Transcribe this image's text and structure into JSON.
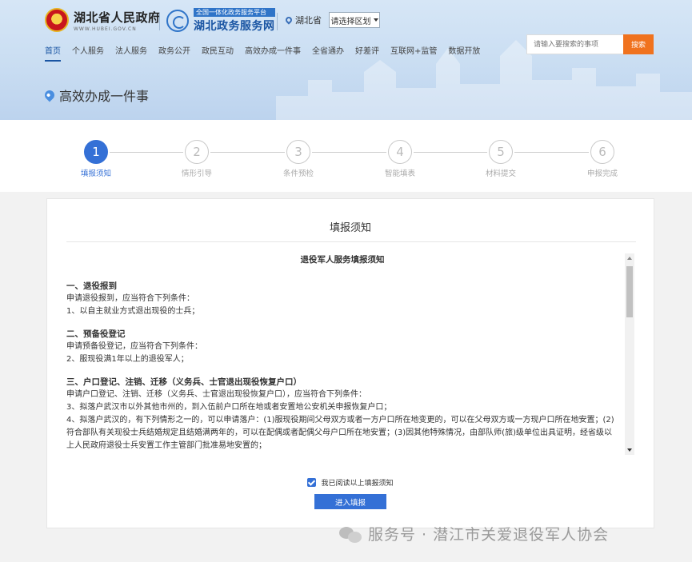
{
  "header": {
    "gov_title": "湖北省人民政府",
    "gov_subtitle": "WWW.HUBEI.GOV.CN",
    "platform_tag": "全国一体化政务服务平台",
    "platform_name": "湖北政务服务网",
    "region_label": "湖北省",
    "region_select": "请选择区划",
    "search_placeholder": "请输入要搜索的事项",
    "search_button": "搜索"
  },
  "nav": {
    "items": [
      "首页",
      "个人服务",
      "法人服务",
      "政务公开",
      "政民互动",
      "高效办成一件事",
      "全省通办",
      "好差评",
      "互联网+监管",
      "数据开放"
    ],
    "active_index": 0
  },
  "page": {
    "title": "高效办成一件事"
  },
  "steps": [
    {
      "num": "1",
      "label": "填报须知",
      "active": true
    },
    {
      "num": "2",
      "label": "情形引导",
      "active": false
    },
    {
      "num": "3",
      "label": "条件预检",
      "active": false
    },
    {
      "num": "4",
      "label": "智能填表",
      "active": false
    },
    {
      "num": "5",
      "label": "材料提交",
      "active": false
    },
    {
      "num": "6",
      "label": "申报完成",
      "active": false
    }
  ],
  "panel": {
    "title": "填报须知",
    "notice_heading": "退役军人服务填报须知",
    "sections": [
      {
        "title": "一、退役报到",
        "lines": [
          "申请退役报到，应当符合下列条件：",
          "1、以自主就业方式退出现役的士兵；"
        ]
      },
      {
        "title": "二、预备役登记",
        "lines": [
          "申请预备役登记，应当符合下列条件：",
          "2、服现役满1年以上的退役军人；"
        ]
      },
      {
        "title": "三、户口登记、注销、迁移（义务兵、士官退出现役恢复户口）",
        "lines": [
          "申请户口登记、注销、迁移（义务兵、士官退出现役恢复户口），应当符合下列条件：",
          "3、拟落户武汉市以外其他市州的，到入伍前户口所在地或者安置地公安机关申报恢复户口；",
          "4、拟落户武汉的，有下列情形之一的，可以申请落户：(1)服现役期间父母双方或者一方户口所在地变更的，可以在父母双方或一方现户口所在地安置；(2)符合部队有关现役士兵结婚规定且结婚满两年的，可以在配偶或者配偶父母户口所在地安置；(3)因其他特殊情况，由部队师(旅)级单位出具证明，经省级以上人民政府退役士兵安置工作主管部门批准易地安置的；"
        ]
      }
    ],
    "agree_text": "我已阅读以上填报须知",
    "agree_checked": true,
    "enter_button": "进入填报"
  },
  "watermark": {
    "text": "服务号 · 潜江市关爱退役军人协会"
  },
  "colors": {
    "accent": "#3470d6",
    "search_button": "#f0721e",
    "header_bg": "#c9ddf2"
  }
}
